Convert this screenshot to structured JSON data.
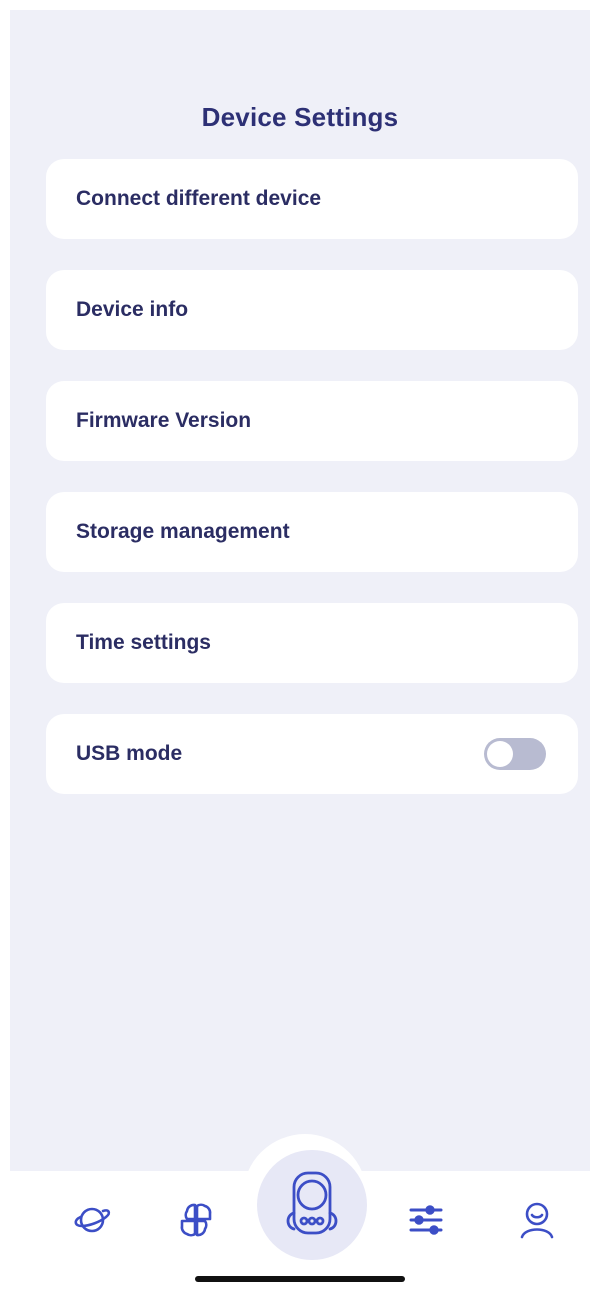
{
  "header": {
    "title": "Device Settings"
  },
  "menu": {
    "items": [
      {
        "label": "Connect different device"
      },
      {
        "label": "Device info"
      },
      {
        "label": "Firmware Version"
      },
      {
        "label": "Storage management"
      },
      {
        "label": "Time settings"
      },
      {
        "label": "USB mode",
        "toggle_on": false
      }
    ]
  },
  "tabbar": {
    "tabs": [
      {
        "icon": "planet-icon"
      },
      {
        "icon": "apps-grid-icon"
      },
      {
        "icon": "recorder-device-icon",
        "selected": true
      },
      {
        "icon": "sliders-icon"
      },
      {
        "icon": "profile-icon"
      }
    ]
  },
  "colors": {
    "background": "#eff0f8",
    "card": "#ffffff",
    "text_primary": "#2b2d63",
    "accent": "#3c4ec6",
    "toggle_off": "#b8bbd1",
    "center_tab_bg": "#e7e8f6"
  }
}
